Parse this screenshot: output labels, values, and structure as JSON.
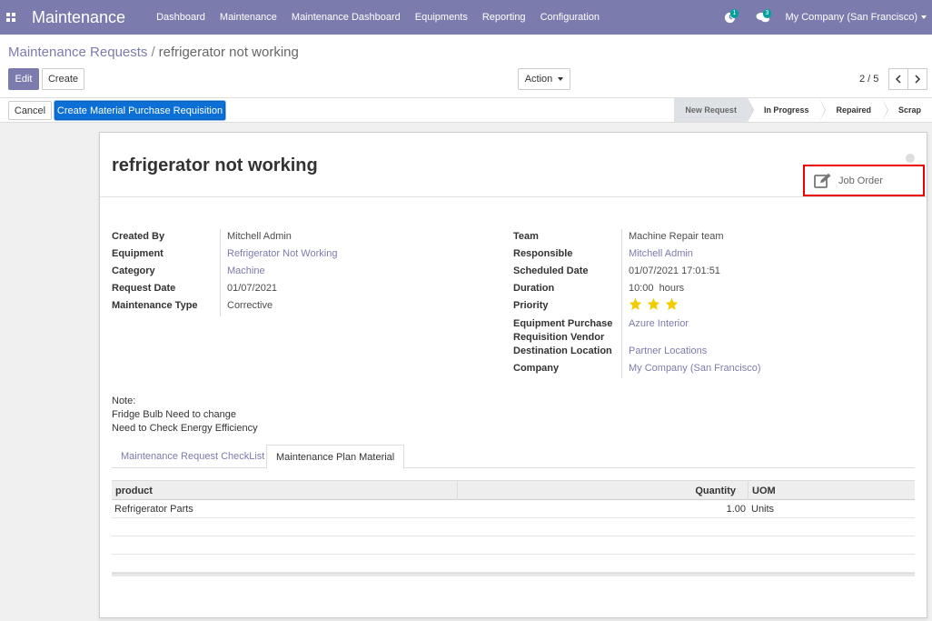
{
  "navbar": {
    "brand": "Maintenance",
    "menu": [
      "Dashboard",
      "Maintenance",
      "Maintenance Dashboard",
      "Equipments",
      "Reporting",
      "Configuration"
    ],
    "activity_count": "1",
    "message_count": "3",
    "company": "My Company (San Francisco)"
  },
  "breadcrumb": {
    "parent": "Maintenance Requests",
    "separator": "/",
    "current": "refrigerator not working"
  },
  "buttons": {
    "edit": "Edit",
    "create": "Create",
    "action": "Action",
    "cancel": "Cancel",
    "create_mpr": "Create Material Purchase Requisition"
  },
  "pager": {
    "text": "2 / 5"
  },
  "stages": [
    "New Request",
    "In Progress",
    "Repaired",
    "Scrap"
  ],
  "active_stage": "New Request",
  "record": {
    "title": "refrigerator not working",
    "smart_button": "Job Order",
    "left_fields": [
      {
        "label": "Created By",
        "value": "Mitchell Admin",
        "link": false
      },
      {
        "label": "Equipment",
        "value": "Refrigerator Not Working",
        "link": true
      },
      {
        "label": "Category",
        "value": "Machine",
        "link": true
      },
      {
        "label": "Request Date",
        "value": "01/07/2021",
        "link": false
      },
      {
        "label": "Maintenance Type",
        "value": "Corrective",
        "link": false
      }
    ],
    "right_fields": {
      "team_label": "Team",
      "team": "Machine Repair team",
      "responsible_label": "Responsible",
      "responsible": "Mitchell Admin",
      "scheduled_label": "Scheduled Date",
      "scheduled": "01/07/2021 17:01:51",
      "duration_label": "Duration",
      "duration": "10:00",
      "duration_unit": "hours",
      "priority_label": "Priority",
      "priority": 3,
      "vendor_label_1": "Equipment Purchase",
      "vendor_label_2": "Requisition Vendor",
      "vendor": "Azure Interior",
      "destination_label": "Destination Location",
      "destination": "Partner Locations",
      "company_label": "Company",
      "company": "My Company (San Francisco)"
    },
    "note": [
      "Note:",
      "Fridge Bulb Need to change",
      "Need to Check Energy Efficiency"
    ]
  },
  "tabs": [
    "Maintenance Request CheckList",
    "Maintenance Plan Material"
  ],
  "active_tab": "Maintenance Plan Material",
  "table": {
    "headers": {
      "product": "product",
      "quantity": "Quantity",
      "uom": "UOM"
    },
    "rows": [
      {
        "product": "Refrigerator Parts",
        "quantity": "1.00",
        "uom": "Units"
      }
    ]
  },
  "colors": {
    "navbar": "#7c7bad",
    "primary_button": "#0b6fd6",
    "link": "#7c7bad",
    "star": "#f3cc00",
    "highlight_border": "#ee0000"
  },
  "icons": {
    "apps": "apps-grid-icon",
    "activity": "clock-icon",
    "messages": "chat-icon",
    "smart_button": "edit-icon",
    "pager_prev": "chevron-left-icon",
    "pager_next": "chevron-right-icon"
  }
}
